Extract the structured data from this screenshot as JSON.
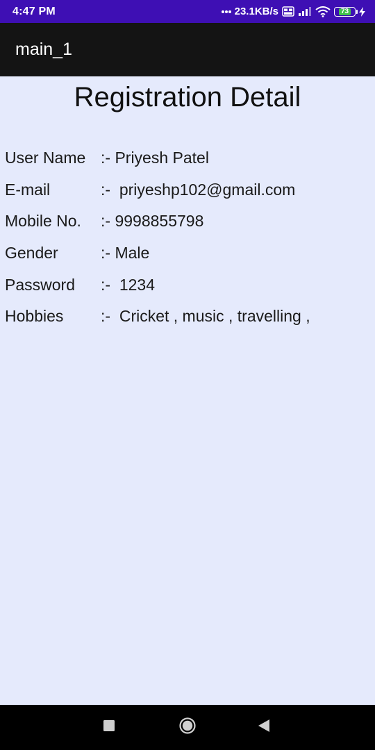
{
  "status_bar": {
    "time": "4:47 PM",
    "network_speed": "23.1KB/s",
    "battery_level": "73",
    "icons": [
      "dots-icon",
      "volte-icon",
      "signal-icon",
      "wifi-icon",
      "battery-icon",
      "charging-icon"
    ]
  },
  "app_bar": {
    "title": "main_1"
  },
  "page": {
    "title": "Registration Detail",
    "details": [
      {
        "label": "User Name",
        "value": ":- Priyesh Patel"
      },
      {
        "label": "E-mail",
        "value": ":-  priyeshp102@gmail.com"
      },
      {
        "label": "Mobile No.",
        "value": ":- 9998855798"
      },
      {
        "label": "Gender",
        "value": ":- Male"
      },
      {
        "label": "Password",
        "value": ":-  1234"
      },
      {
        "label": "Hobbies",
        "value": ":-  Cricket , music , travelling ,"
      }
    ]
  },
  "nav_bar": {
    "icons": [
      "recent-apps-icon",
      "home-icon",
      "back-icon"
    ]
  },
  "colors": {
    "status_bar": "#3e0fb4",
    "app_bar": "#141414",
    "background": "#e5eafc",
    "nav_bar": "#000000",
    "battery_fill": "#41c24a"
  }
}
